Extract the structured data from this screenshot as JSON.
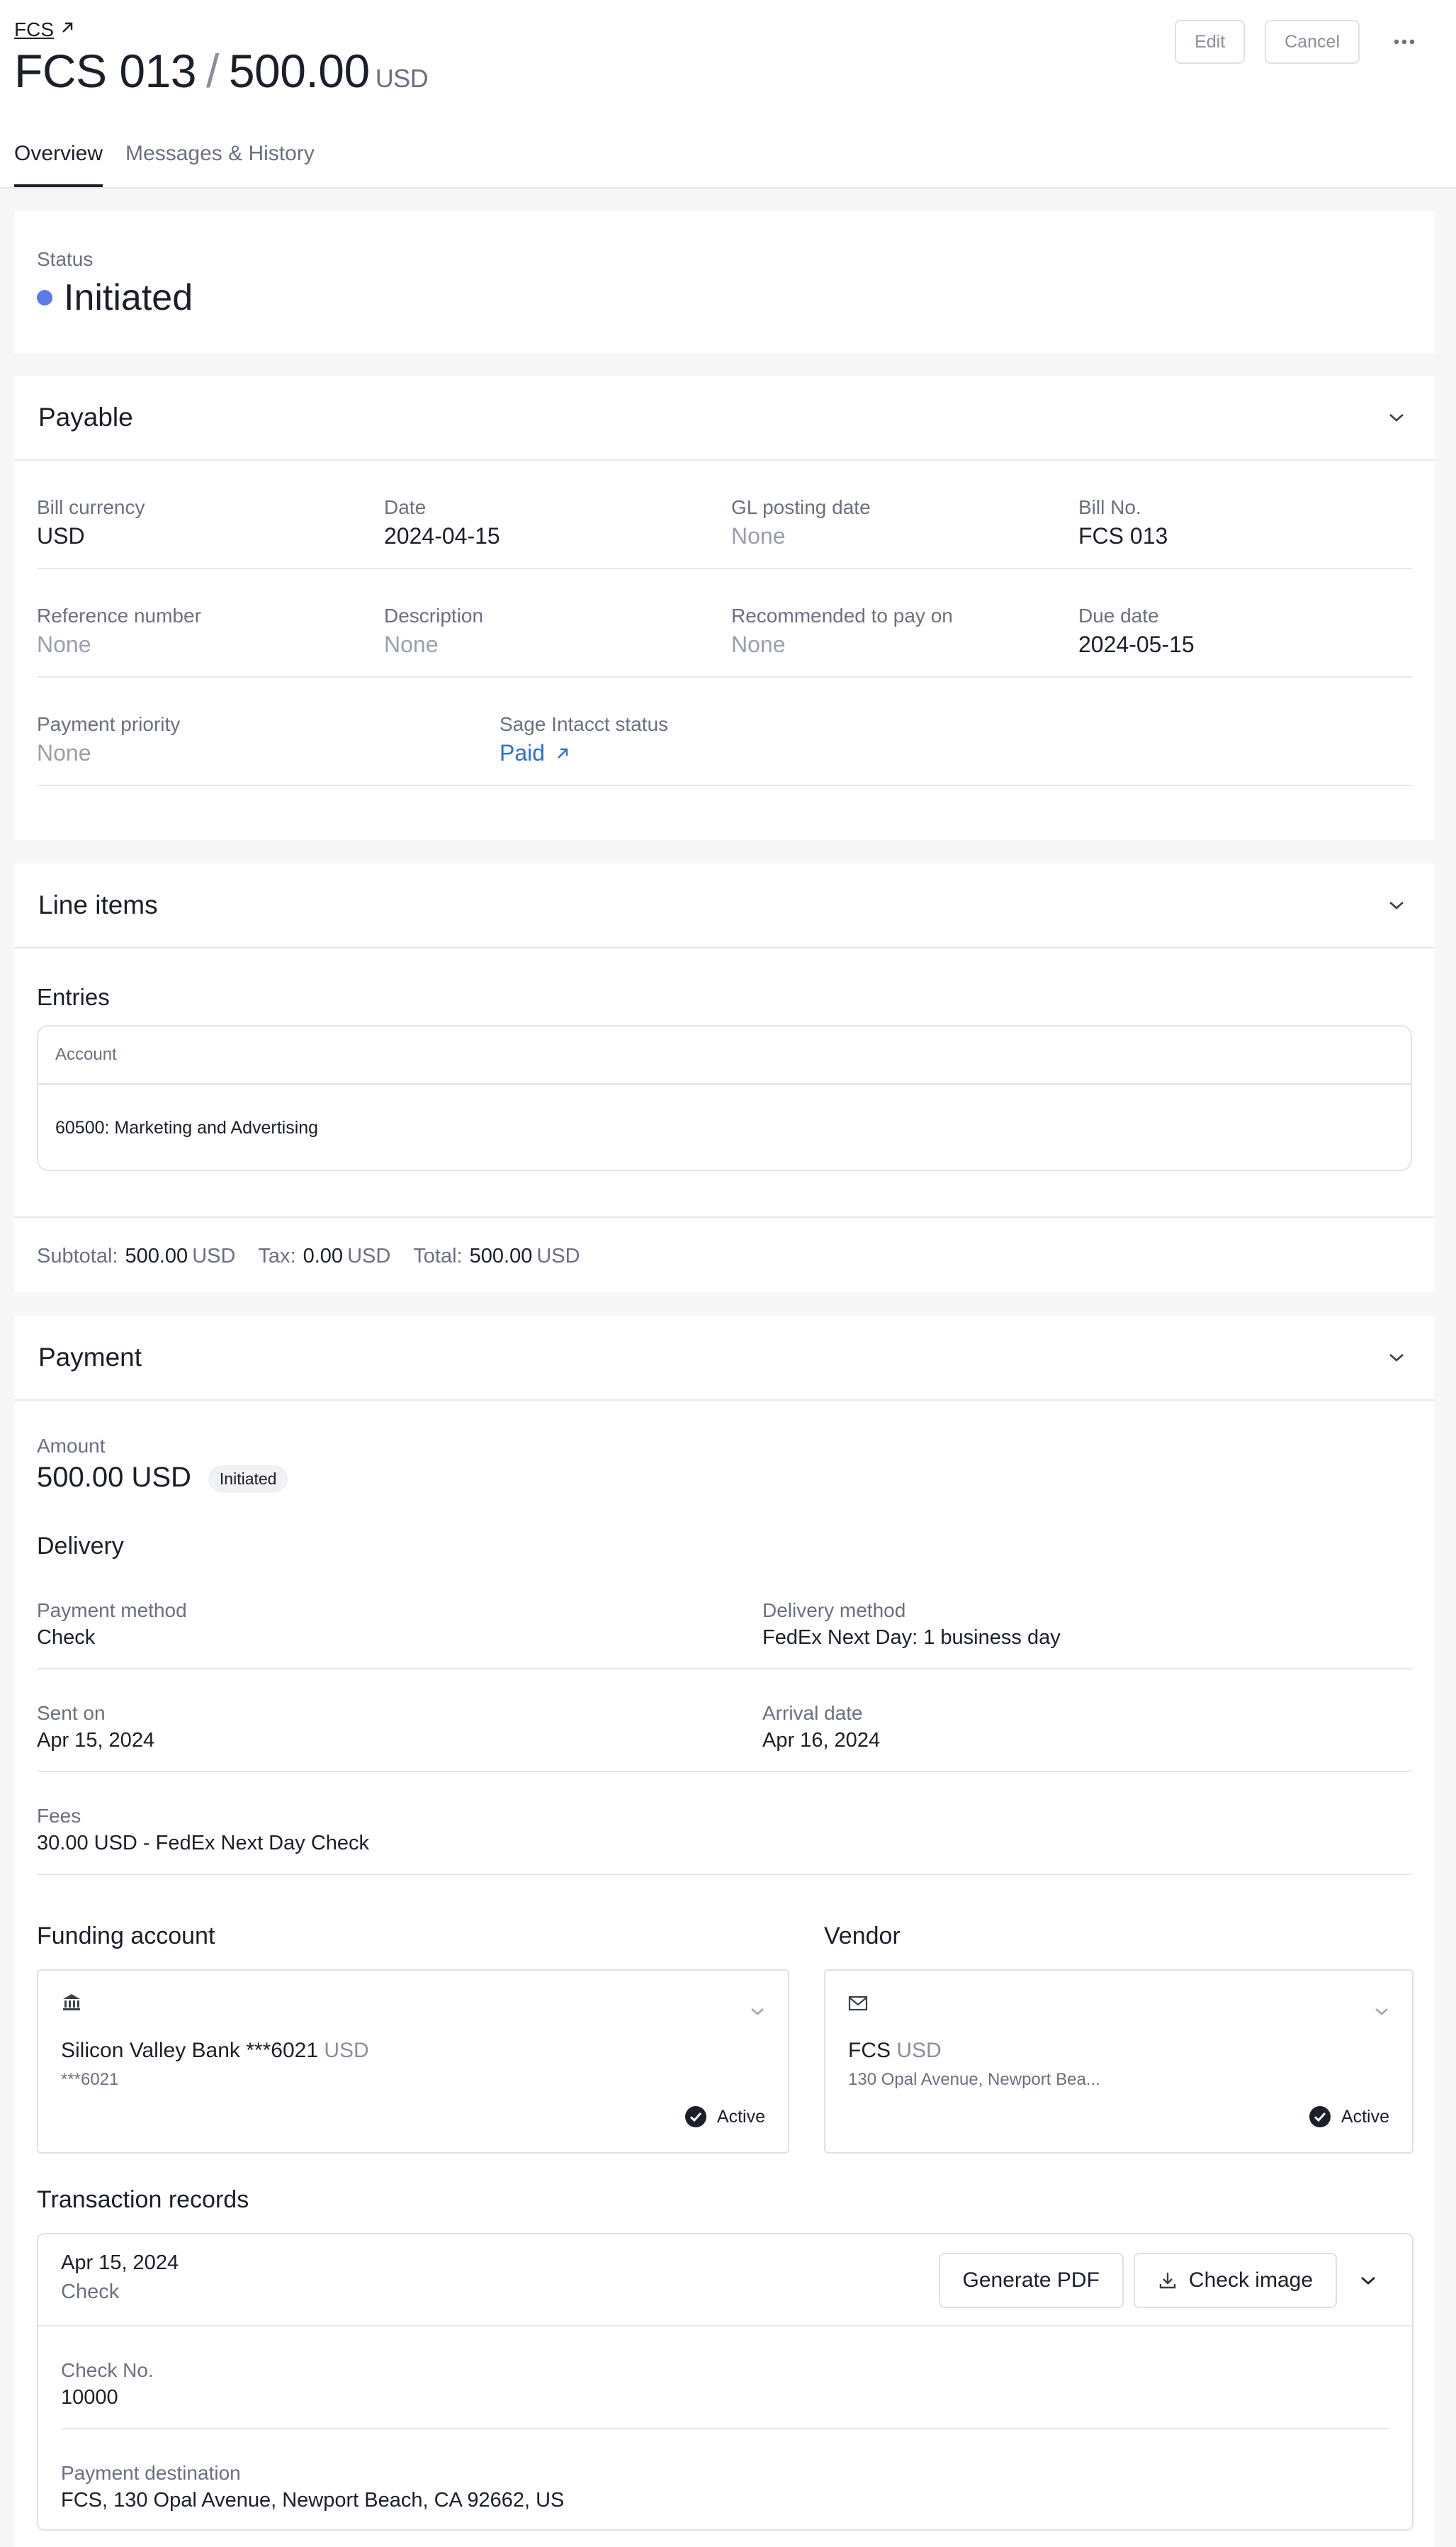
{
  "header": {
    "breadcrumb": "FCS",
    "bill_no": "FCS 013",
    "amount": "500.00",
    "currency": "USD",
    "edit_label": "Edit",
    "cancel_label": "Cancel"
  },
  "tabs": [
    {
      "label": "Overview",
      "active": true
    },
    {
      "label": "Messages & History",
      "active": false
    }
  ],
  "status": {
    "label": "Status",
    "value": "Initiated",
    "color": "#5b7bea"
  },
  "payable": {
    "title": "Payable",
    "fields": [
      {
        "label": "Bill currency",
        "value": "USD"
      },
      {
        "label": "Date",
        "value": "2024-04-15"
      },
      {
        "label": "GL posting date",
        "value": "None"
      },
      {
        "label": "Bill No.",
        "value": "FCS 013"
      },
      {
        "label": "Reference number",
        "value": "None"
      },
      {
        "label": "Description",
        "value": "None"
      },
      {
        "label": "Recommended to pay on",
        "value": "None"
      },
      {
        "label": "Due date",
        "value": "2024-05-15"
      },
      {
        "label": "Payment priority",
        "value": "None"
      },
      {
        "label": "Sage Intacct status",
        "value": "Paid"
      }
    ]
  },
  "line_items": {
    "title": "Line items",
    "entries_label": "Entries",
    "column": "Account",
    "rows": [
      "60500: Marketing and Advertising"
    ],
    "subtotal_label": "Subtotal:",
    "subtotal": "500.00",
    "tax_label": "Tax:",
    "tax": "0.00",
    "total_label": "Total:",
    "total": "500.00",
    "currency": "USD"
  },
  "payment": {
    "title": "Payment",
    "amount_label": "Amount",
    "amount": "500.00 USD",
    "status_pill": "Initiated",
    "delivery_heading": "Delivery",
    "fields": [
      {
        "label": "Payment method",
        "value": "Check"
      },
      {
        "label": "Delivery method",
        "value": "FedEx Next Day: 1 business day"
      },
      {
        "label": "Sent on",
        "value": "Apr 15, 2024"
      },
      {
        "label": "Arrival date",
        "value": "Apr 16, 2024"
      },
      {
        "label": "Fees",
        "value": "30.00 USD - FedEx Next Day Check"
      }
    ],
    "funding": {
      "heading": "Funding account",
      "name": "Silicon Valley Bank ***6021",
      "currency": "USD",
      "sub": "***6021",
      "status": "Active",
      "icon": "bank-icon"
    },
    "vendor": {
      "heading": "Vendor",
      "name": "FCS",
      "currency": "USD",
      "sub": "130 Opal Avenue, Newport Bea...",
      "status": "Active",
      "icon": "mail-icon"
    }
  },
  "transactions": {
    "heading": "Transaction records",
    "date": "Apr 15, 2024",
    "type": "Check",
    "generate_pdf_label": "Generate PDF",
    "check_image_label": "Check image",
    "check_no_label": "Check No.",
    "check_no": "10000",
    "destination_label": "Payment destination",
    "destination": "FCS, 130 Opal Avenue, Newport Beach, CA 92662, US"
  }
}
